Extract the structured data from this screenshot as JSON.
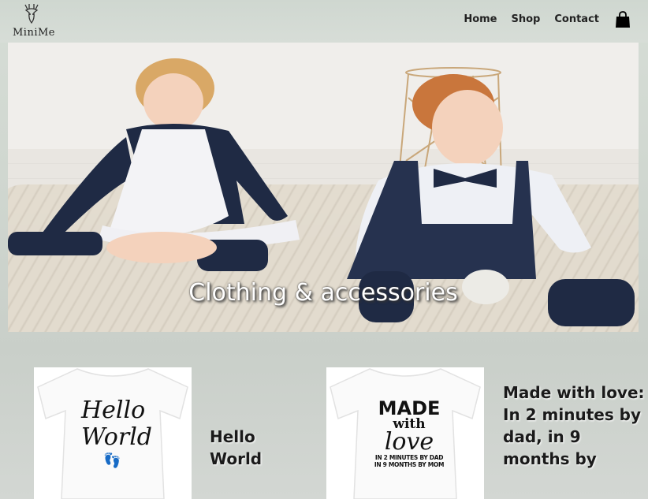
{
  "brand": {
    "logo_text": "MiniMe",
    "logo_icon": "deer-icon"
  },
  "nav": {
    "items": [
      "Home",
      "Shop",
      "Contact"
    ],
    "cart_icon": "shopping-bag-icon"
  },
  "hero": {
    "title": "Clothing & accessories"
  },
  "products": [
    {
      "name": "Hello World",
      "print": {
        "line1": "Hello",
        "line2": "World"
      }
    },
    {
      "name": "Made with love: In 2 minutes by dad, in 9 months by",
      "print": {
        "line1": "MADE",
        "line2": "with",
        "line3": "love",
        "line4": "IN 2 MINUTES BY DAD",
        "line5": "IN 9 MONTHS BY MOM"
      }
    }
  ],
  "colors": {
    "nav_text": "#222222",
    "hero_text": "#ffffff"
  }
}
